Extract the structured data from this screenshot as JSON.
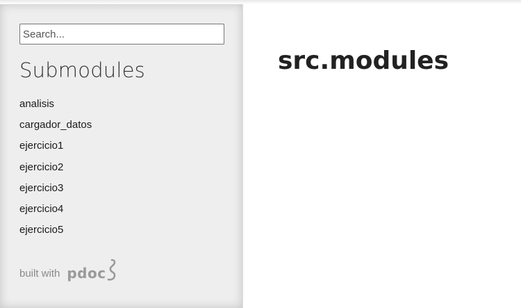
{
  "search": {
    "placeholder": "Search..."
  },
  "sidebar": {
    "heading": "Submodules",
    "items": [
      {
        "label": "analisis"
      },
      {
        "label": "cargador_datos"
      },
      {
        "label": "ejercicio1"
      },
      {
        "label": "ejercicio2"
      },
      {
        "label": "ejercicio3"
      },
      {
        "label": "ejercicio4"
      },
      {
        "label": "ejercicio5"
      }
    ],
    "footer": {
      "built_with": "built with",
      "brand": "pdoc",
      "brand_icon": "pdoc-snake-icon"
    }
  },
  "main": {
    "title": "src.modules"
  },
  "colors": {
    "sidebar_bg": "#eeeeee",
    "text": "#222222",
    "muted": "#8a8a8a"
  }
}
